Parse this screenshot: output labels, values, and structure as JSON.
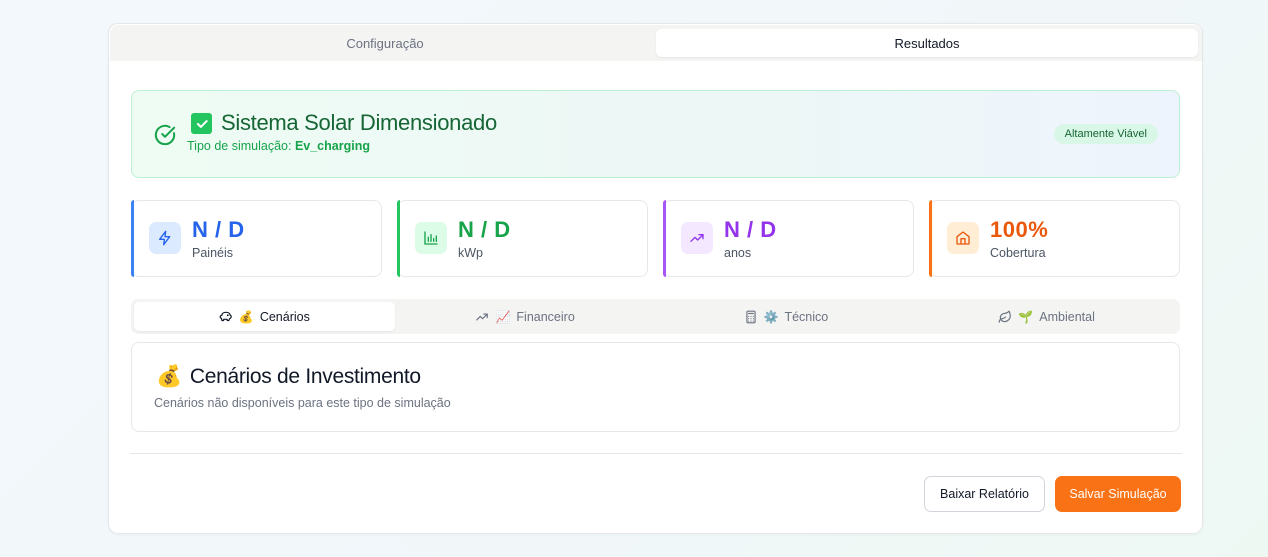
{
  "top_tabs": [
    {
      "label": "Configuração",
      "active": false
    },
    {
      "label": "Resultados",
      "active": true
    }
  ],
  "banner": {
    "title": "Sistema Solar Dimensionado",
    "subtitle_prefix": "Tipo de simulação:",
    "subtitle_value": "Ev_charging",
    "badge": "Altamente Viável"
  },
  "stats": [
    {
      "value": "N / D",
      "label": "Painéis",
      "icon": "zap-icon",
      "color": "#2563eb"
    },
    {
      "value": "N / D",
      "label": "kWp",
      "icon": "bar-chart-icon",
      "color": "#16a34a"
    },
    {
      "value": "N / D",
      "label": "anos",
      "icon": "trending-up-icon",
      "color": "#9333ea"
    },
    {
      "value": "100%",
      "label": "Cobertura",
      "icon": "home-icon",
      "color": "#ea580c"
    }
  ],
  "sub_tabs": [
    {
      "label": "Cenários",
      "emoji": "💰",
      "active": true
    },
    {
      "label": "Financeiro",
      "emoji": "📈",
      "active": false
    },
    {
      "label": "Técnico",
      "emoji": "⚙️",
      "active": false
    },
    {
      "label": "Ambiental",
      "emoji": "🌱",
      "active": false
    }
  ],
  "panel": {
    "emoji": "💰",
    "title": "Cenários de Investimento",
    "description": "Cenários não disponíveis para este tipo de simulação"
  },
  "actions": {
    "download_label": "Baixar Relatório",
    "save_label": "Salvar Simulação"
  }
}
